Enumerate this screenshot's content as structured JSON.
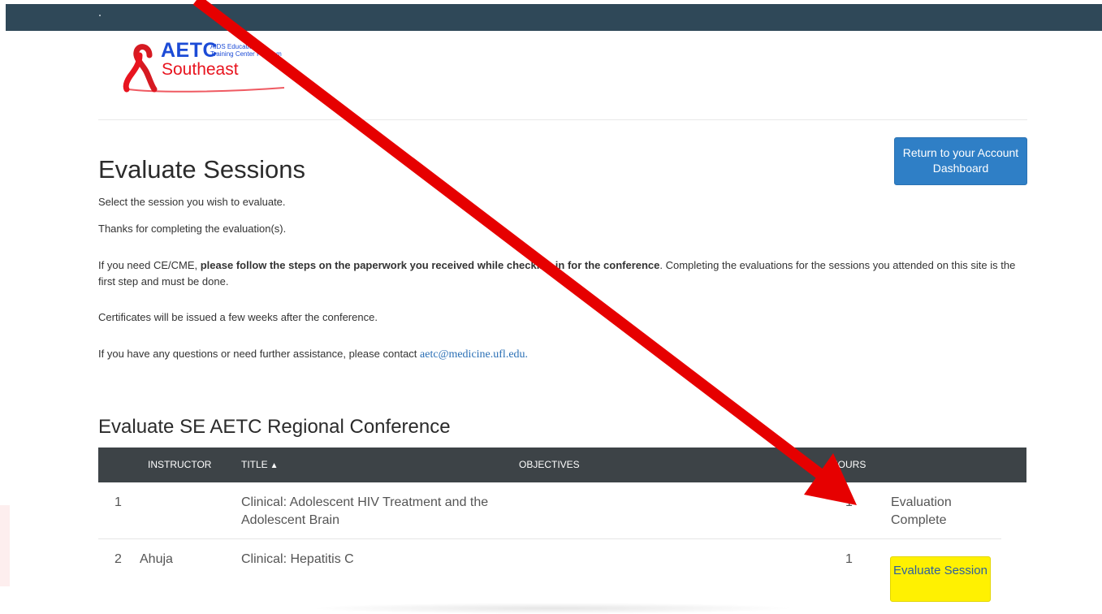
{
  "logo": {
    "brand": "AETC",
    "tagline": "AIDS Education\nTraining Center Program",
    "region": "Southeast"
  },
  "header": {
    "title": "Evaluate Sessions",
    "dashboard_button": "Return to your Account Dashboard"
  },
  "intro": {
    "select_text": "Select the session you wish to evaluate.",
    "thanks_text": "Thanks for completing the evaluation(s).",
    "ce_prefix": "If you need CE/CME, ",
    "ce_bold": "please follow the steps on the paperwork you received while checking in for the conference",
    "ce_suffix": ". Completing the evaluations for the sessions you attended on this site is the first step and must be done.",
    "certificates_text": "Certificates will be issued a few weeks after the conference.",
    "contact_prefix": "If you have any questions or need further assistance, please contact ",
    "contact_email": "aetc@medicine.ufl.edu."
  },
  "conference": {
    "title": "Evaluate SE AETC Regional Conference",
    "columns": {
      "instructor": "INSTRUCTOR",
      "title": "TITLE",
      "objectives": "OBJECTIVES",
      "hours": "HOURS"
    },
    "sort_arrow": "▲",
    "rows": [
      {
        "num": "1",
        "instructor": "",
        "title": "Clinical: Adolescent HIV Treatment and the Adolescent Brain",
        "objectives": "",
        "hours": "1",
        "status": "Evaluation Complete"
      },
      {
        "num": "2",
        "instructor": "Ahuja",
        "title": "Clinical: Hepatitis C",
        "objectives": "",
        "hours": "1",
        "action": "Evaluate Session"
      }
    ]
  },
  "colors": {
    "topbar": "#2f4858",
    "primary_button": "#2f7fc6",
    "evaluate_button": "#fff101",
    "table_header": "#3d4347",
    "annotation_arrow": "#e60000",
    "logo_blue": "#1c4bd6",
    "logo_red": "#e8141f"
  },
  "icons": {
    "logo_ribbon": "red-ribbon-icon",
    "annotation": "red-arrow-icon"
  }
}
